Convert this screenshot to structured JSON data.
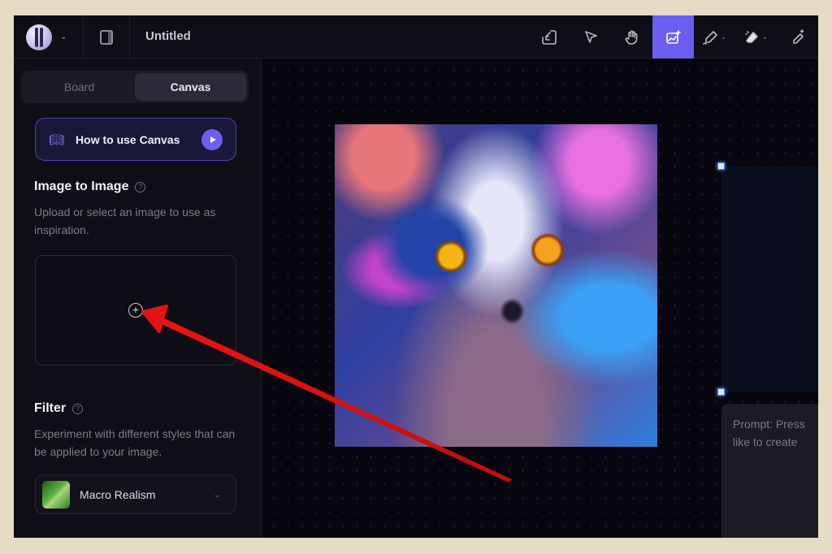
{
  "header": {
    "doc_title": "Untitled",
    "tools": [
      {
        "name": "import-tool",
        "icon": "import-icon",
        "active": false
      },
      {
        "name": "select-tool",
        "icon": "cursor-icon",
        "active": false
      },
      {
        "name": "pan-tool",
        "icon": "hand-icon",
        "active": false
      },
      {
        "name": "generate-image-tool",
        "icon": "image-sparkle-icon",
        "active": true
      },
      {
        "name": "draw-tool",
        "icon": "pencil-icon",
        "active": false
      },
      {
        "name": "erase-tool",
        "icon": "eraser-icon",
        "active": false
      },
      {
        "name": "ai-pencil-tool",
        "icon": "magic-pencil-icon",
        "active": false
      }
    ],
    "accent_color": "#6a5ff0"
  },
  "sidebar": {
    "tabs": [
      {
        "label": "Board",
        "active": false
      },
      {
        "label": "Canvas",
        "active": true
      }
    ],
    "howto_label": "How to use Canvas",
    "image_to_image": {
      "title": "Image to Image",
      "description": "Upload or select an image to use as inspiration."
    },
    "filter": {
      "title": "Filter",
      "description": "Experiment with different styles that can be applied to your image.",
      "selected": "Macro Realism"
    }
  },
  "canvas": {
    "image_alt": "Neon colorful cat portrait with amber eyes",
    "prompt_placeholder": "Prompt: Press like to create"
  },
  "annotation": {
    "arrow_color": "#e01010",
    "points_to": "upload-image-plus-button"
  }
}
